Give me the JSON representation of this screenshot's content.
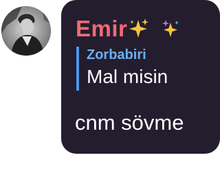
{
  "message": {
    "sender_name": "Emir",
    "sender_name_color": "#ef6a73",
    "sender_decorations": [
      "sparkles-icon",
      "sparkles-icon"
    ],
    "reply": {
      "author": "Zorbabiri",
      "author_color": "#6ab0f4",
      "accent_color": "#4f97ec",
      "text": "Mal misin"
    },
    "text": "cnm sövme",
    "bubble_color": "#231d2e"
  },
  "avatar": {
    "icon": "user-avatar-photo"
  }
}
